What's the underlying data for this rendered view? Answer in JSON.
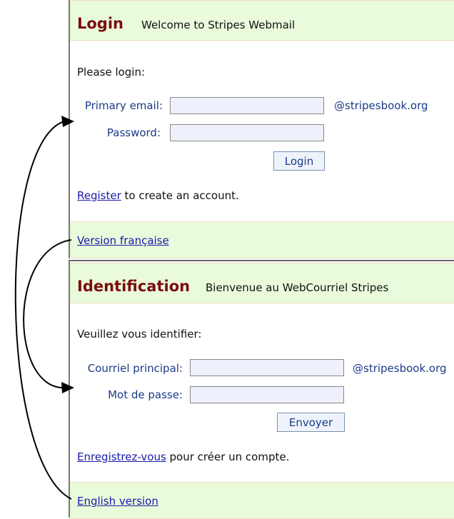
{
  "english": {
    "title": "Login",
    "subtitle": "Welcome to Stripes Webmail",
    "prompt": "Please login:",
    "email_label": "Primary email:",
    "email_value": "",
    "domain": "@stripesbook.org",
    "password_label": "Password:",
    "password_value": "",
    "submit_label": "Login",
    "register_link": "Register",
    "register_rest": " to create an account.",
    "switch_link": "Version française"
  },
  "french": {
    "title": "Identification",
    "subtitle": "Bienvenue au WebCourriel Stripes",
    "prompt": "Veuillez vous identifier:",
    "email_label": "Courriel principal:",
    "email_value": "",
    "domain": "@stripesbook.org",
    "password_label": "Mot de passe:",
    "password_value": "",
    "submit_label": "Envoyer",
    "register_link": "Enregistrez-vous",
    "register_rest": " pour créer un compte.",
    "switch_link": "English version"
  }
}
